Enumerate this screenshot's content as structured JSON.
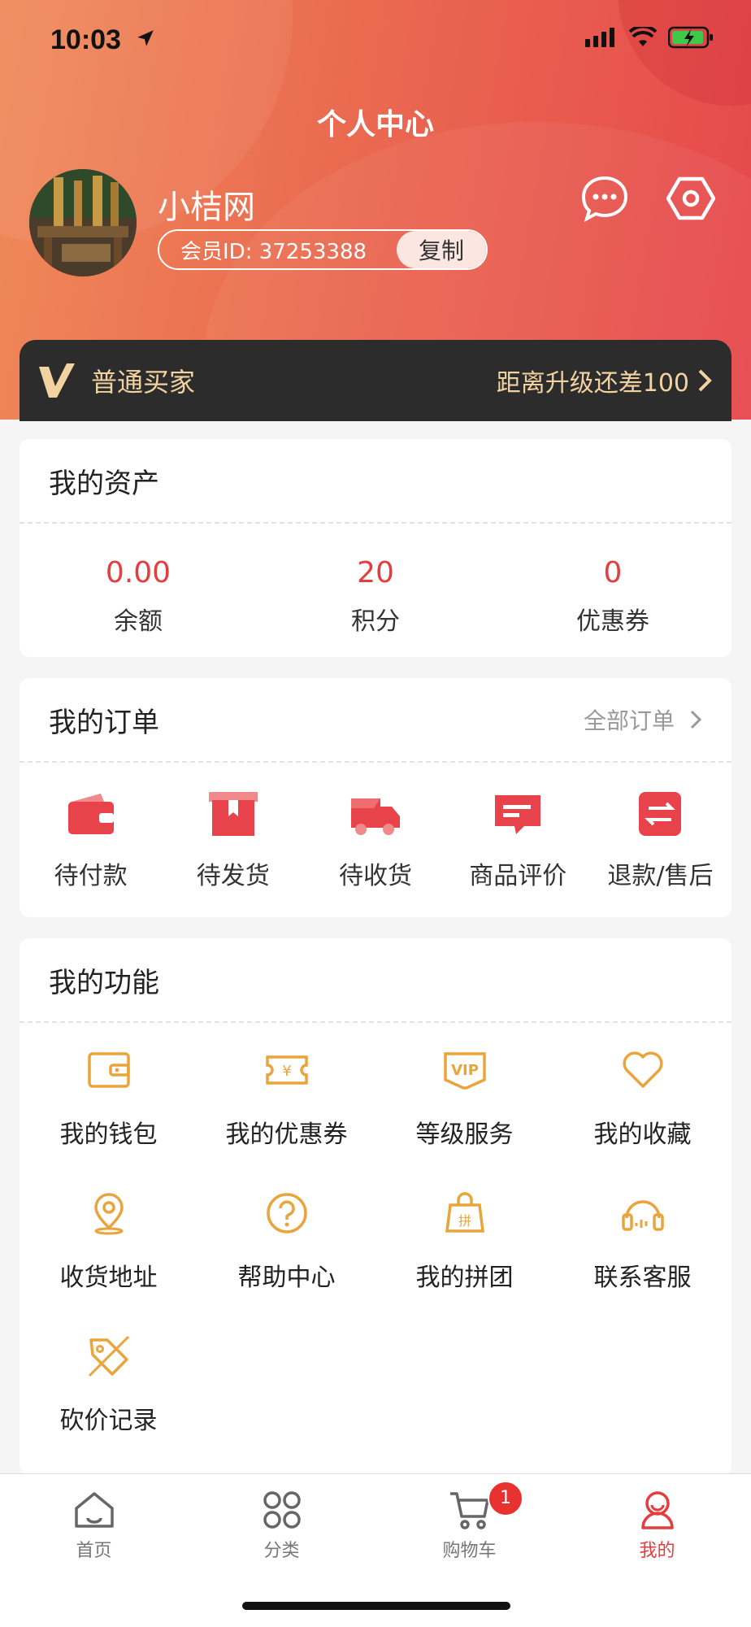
{
  "status": {
    "time": "10:03"
  },
  "header": {
    "title": "个人中心",
    "username": "小桔网",
    "member_id": "会员ID: 37253388",
    "copy_label": "复制"
  },
  "vip": {
    "level": "普通买家",
    "upgrade_text": "距离升级还差100"
  },
  "assets": {
    "title": "我的资产",
    "items": [
      {
        "value": "0.00",
        "label": "余额"
      },
      {
        "value": "20",
        "label": "积分"
      },
      {
        "value": "0",
        "label": "优惠券"
      }
    ]
  },
  "orders": {
    "title": "我的订单",
    "all_label": "全部订单",
    "items": [
      {
        "label": "待付款",
        "icon": "wallet-icon"
      },
      {
        "label": "待发货",
        "icon": "box-icon"
      },
      {
        "label": "待收货",
        "icon": "truck-icon"
      },
      {
        "label": "商品评价",
        "icon": "comment-icon"
      },
      {
        "label": "退款/售后",
        "icon": "refund-icon"
      }
    ]
  },
  "functions": {
    "title": "我的功能",
    "items": [
      {
        "label": "我的钱包",
        "icon": "wallet-icon"
      },
      {
        "label": "我的优惠券",
        "icon": "coupon-icon"
      },
      {
        "label": "等级服务",
        "icon": "vip-icon"
      },
      {
        "label": "我的收藏",
        "icon": "heart-icon"
      },
      {
        "label": "收货地址",
        "icon": "location-icon"
      },
      {
        "label": "帮助中心",
        "icon": "help-icon"
      },
      {
        "label": "我的拼团",
        "icon": "group-buy-icon"
      },
      {
        "label": "联系客服",
        "icon": "headset-icon"
      },
      {
        "label": "砍价记录",
        "icon": "bargain-tag-icon"
      }
    ]
  },
  "tabbar": {
    "items": [
      {
        "label": "首页",
        "icon": "home-icon"
      },
      {
        "label": "分类",
        "icon": "category-icon"
      },
      {
        "label": "购物车",
        "icon": "cart-icon",
        "badge": "1"
      },
      {
        "label": "我的",
        "icon": "user-icon",
        "active": true
      }
    ]
  },
  "colors": {
    "accent": "#e33d3d",
    "orange": "#e9a43c",
    "vip_gold": "#f2d3a0"
  }
}
